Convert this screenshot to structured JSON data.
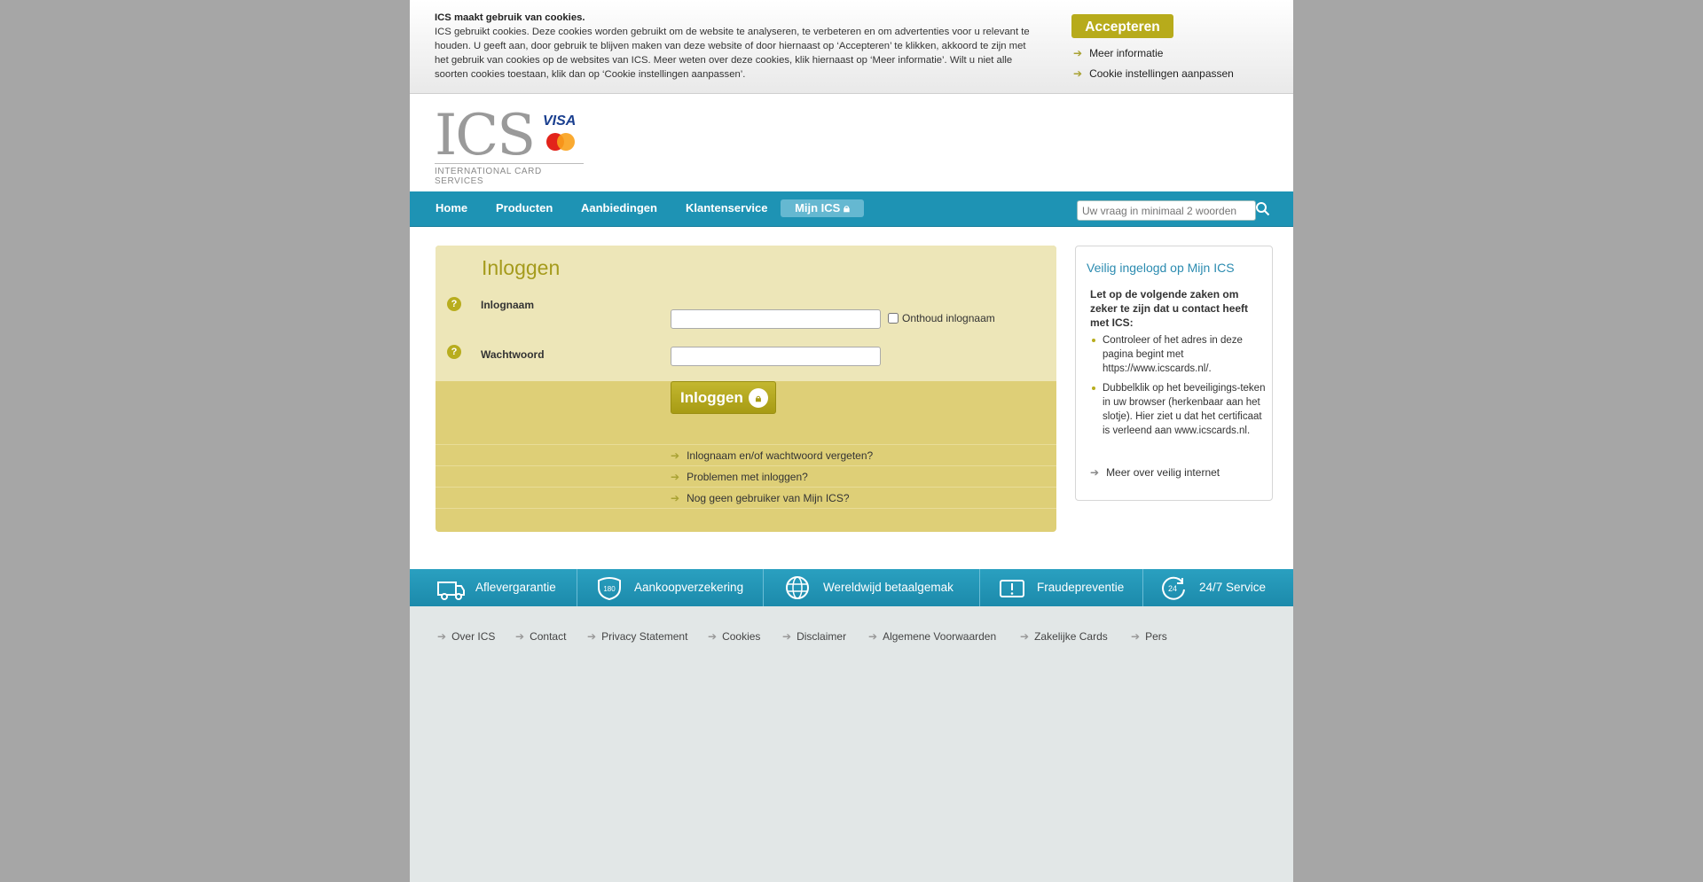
{
  "cookie": {
    "title": "ICS maakt gebruik van cookies.",
    "body": "ICS gebruikt cookies. Deze cookies worden gebruikt om de website te analyseren, te verbeteren en om advertenties voor u relevant te houden. U geeft aan, door gebruik te blijven maken van deze website of door hiernaast op ‘Accepteren’ te klikken, akkoord te zijn met het gebruik van cookies op de websites van ICS. Meer weten over deze cookies, klik hiernaast op ‘Meer informatie’. Wilt u niet alle soorten cookies toestaan, klik dan op ‘Cookie instellingen aanpassen’.",
    "accept_label": "Accepteren",
    "more_info": "Meer informatie",
    "settings": "Cookie instellingen aanpassen"
  },
  "logo": {
    "name": "ICS",
    "visa": "VISA",
    "mastercard": "MasterCard",
    "subtitle": "INTERNATIONAL CARD SERVICES"
  },
  "nav": {
    "items": [
      "Home",
      "Producten",
      "Aanbiedingen",
      "Klantenservice"
    ],
    "mijn_ics": "Mijn ICS",
    "search_placeholder": "Uw vraag in minimaal 2 woorden"
  },
  "login": {
    "title": "Inloggen",
    "username_label": "Inlognaam",
    "password_label": "Wachtwoord",
    "remember_label": "Onthoud inlognaam",
    "submit_label": "Inloggen",
    "links": [
      "Inlognaam en/of wachtwoord vergeten?",
      "Problemen met inloggen?",
      "Nog geen gebruiker van Mijn ICS?"
    ]
  },
  "security": {
    "title": "Veilig ingelogd op Mijn ICS",
    "intro": "Let op de volgende zaken om zeker te zijn dat u contact heeft met ICS:",
    "tips": [
      "Controleer of het adres in deze pagina begint met https://www.icscards.nl/.",
      "Dubbelklik op het beveiligings-teken in uw browser (herkenbaar aan het slotje). Hier ziet u dat het certificaat is verleend aan www.icscards.nl."
    ],
    "more_link": "Meer over veilig internet"
  },
  "features": [
    "Aflevergarantie",
    "Aankoopverzekering",
    "Wereldwijd betaalgemak",
    "Fraudepreventie",
    "24/7 Service"
  ],
  "footer": [
    "Over ICS",
    "Contact",
    "Privacy Statement",
    "Cookies",
    "Disclaimer",
    "Algemene Voorwaarden",
    "Zakelijke Cards",
    "Pers"
  ],
  "colors": {
    "nav_blue": "#1e93b4",
    "gold": "#b7ab1b",
    "login_panel": "#ede6b8",
    "login_panel_dark": "#decf77"
  }
}
